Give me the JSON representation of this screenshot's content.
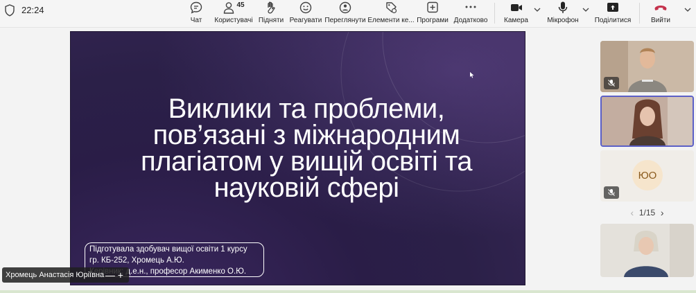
{
  "header": {
    "timer": "22:24",
    "people_count": "45",
    "buttons": {
      "chat": "Чат",
      "people": "Користувачі",
      "raise": "Підняти",
      "react": "Реагувати",
      "view": "Переглянути",
      "elements": "Елементи ке...",
      "apps": "Програми",
      "more": "Додатково",
      "camera": "Камера",
      "mic": "Мікрофон",
      "share": "Поділитися",
      "leave": "Вийти"
    },
    "leave_color": "#c4314b"
  },
  "slide": {
    "title_lines": [
      "Виклики та проблеми,",
      "пов’язані з міжнародним",
      "плагіатом у вищій освіті та",
      "науковій сфері"
    ],
    "author_lines": [
      "Підготувала здобувач вищої освіти 1 курсу",
      "гр. КБ-252, Хромець А.Ю.",
      "Керівник: д.е.н., професор Акименко О.Ю."
    ]
  },
  "presenter": {
    "name": "Хромець Анастасія Юріївна",
    "controls": "— +"
  },
  "rail": {
    "avatar_initials": "ЮО",
    "page": "1/15",
    "accent": "#5b5fc7"
  }
}
